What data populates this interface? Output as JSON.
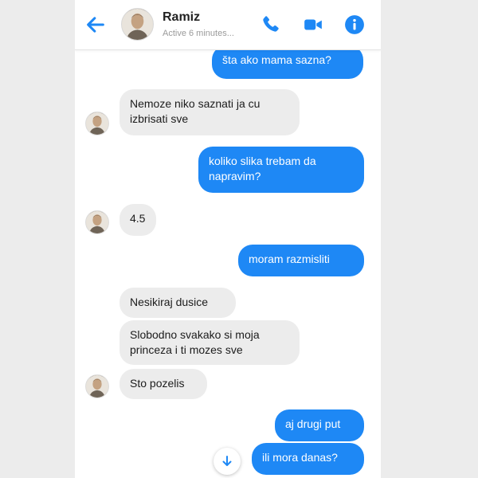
{
  "header": {
    "contact_name": "Ramiz",
    "status": "Active 6 minutes...",
    "icons": [
      "back-arrow-icon",
      "phone-icon",
      "video-icon",
      "info-icon"
    ],
    "accent_color": "#1e88f5"
  },
  "messages": [
    {
      "direction": "outgoing",
      "text": "šta ako mama sazna?"
    },
    {
      "direction": "incoming",
      "text": "Nemoze niko saznati ja cu\nizbrisati sve"
    },
    {
      "direction": "outgoing",
      "text": "koliko slika trebam da\nnapravim?"
    },
    {
      "direction": "incoming",
      "text": "4.5"
    },
    {
      "direction": "outgoing",
      "text": "moram razmisliti"
    },
    {
      "direction": "incoming",
      "text": "Nesikiraj dusice"
    },
    {
      "direction": "incoming",
      "text": "Slobodno svakako si moja\nprinceza i ti mozes sve"
    },
    {
      "direction": "incoming",
      "text": "Sto pozelis"
    },
    {
      "direction": "outgoing",
      "text": "aj drugi put"
    },
    {
      "direction": "outgoing",
      "text": "ili mora danas?"
    }
  ],
  "scroll_button_icon": "arrow-down-icon"
}
